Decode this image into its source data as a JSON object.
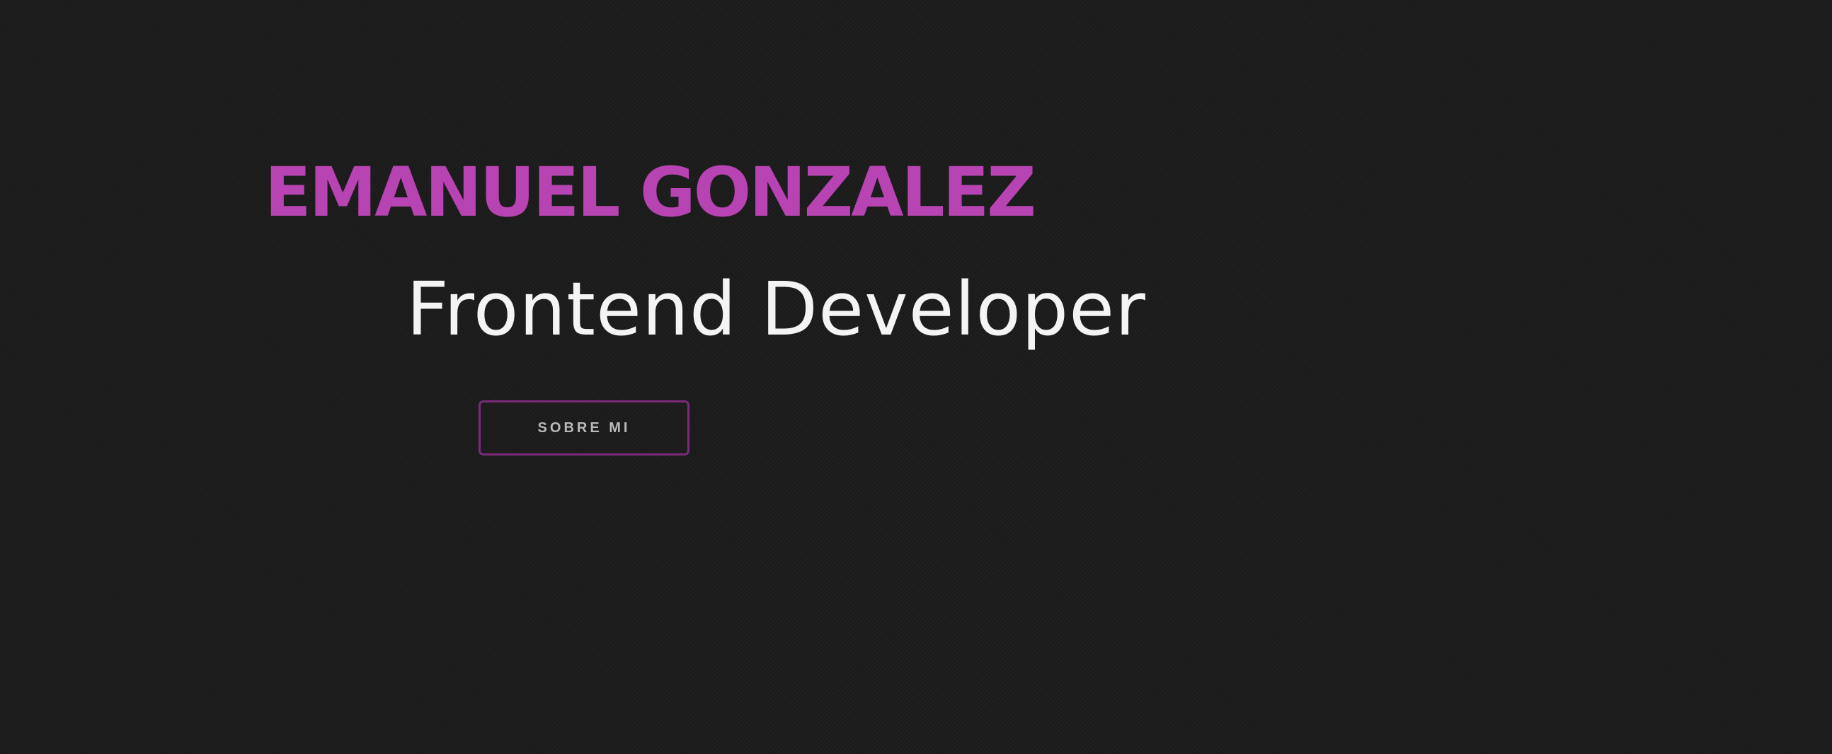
{
  "hero": {
    "name": "EMANUEL GONZALEZ",
    "subtitle": "Frontend Developer",
    "button_label": "SOBRE MI"
  },
  "colors": {
    "background": "#1c1c1c",
    "accent": "#b843b3",
    "button_border": "#7d2a7c",
    "subtitle_text": "#f4f4f4",
    "button_text": "#b9b9b9"
  }
}
